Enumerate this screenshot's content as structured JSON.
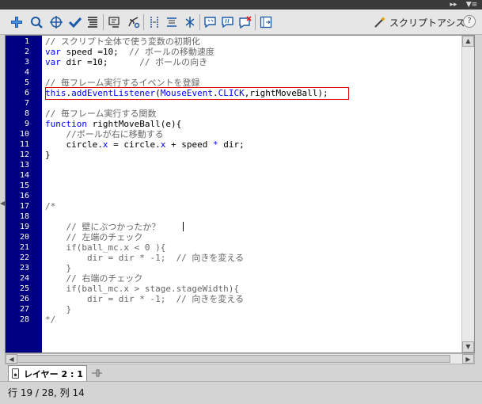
{
  "toolbar": {
    "tools": [
      {
        "icon": "add-statement-icon"
      },
      {
        "icon": "find-icon"
      },
      {
        "icon": "target-path-icon"
      },
      {
        "icon": "check-syntax-icon"
      },
      {
        "icon": "auto-format-icon"
      },
      {
        "icon": "code-hint-icon"
      },
      {
        "icon": "debug-options-icon"
      },
      {
        "icon": "collapse-between-braces-icon"
      },
      {
        "icon": "collapse-selection-icon"
      },
      {
        "icon": "expand-all-icon"
      },
      {
        "icon": "apply-block-comment-icon"
      },
      {
        "icon": "apply-line-comment-icon"
      },
      {
        "icon": "remove-comment-icon"
      },
      {
        "icon": "show-hide-toolbox-icon"
      }
    ],
    "script_assist_label": "スクリプトアシスト",
    "help_label": "?"
  },
  "editor": {
    "line_numbers": [
      "1",
      "2",
      "3",
      "4",
      "5",
      "6",
      "7",
      "8",
      "9",
      "10",
      "11",
      "12",
      "13",
      "14",
      "15",
      "16",
      "17",
      "18",
      "19",
      "20",
      "21",
      "22",
      "23",
      "24",
      "25",
      "26",
      "27",
      "28"
    ],
    "lines": [
      [
        {
          "t": "// スクリプト全体で使う変数の初期化",
          "c": "comment"
        }
      ],
      [
        {
          "t": "var",
          "c": "kw"
        },
        {
          "t": " speed =10;  ",
          "c": "plain"
        },
        {
          "t": "// ボールの移動速度",
          "c": "comment"
        }
      ],
      [
        {
          "t": "var",
          "c": "kw"
        },
        {
          "t": " dir =10;      ",
          "c": "plain"
        },
        {
          "t": "// ボールの向き",
          "c": "comment"
        }
      ],
      [],
      [
        {
          "t": "// 毎フレーム実行するイベントを登録",
          "c": "comment"
        }
      ],
      [
        {
          "t": "this",
          "c": "kw"
        },
        {
          "t": ".",
          "c": "plain"
        },
        {
          "t": "addEventListener",
          "c": "kw"
        },
        {
          "t": "(",
          "c": "plain"
        },
        {
          "t": "MouseEvent",
          "c": "kw"
        },
        {
          "t": ".",
          "c": "plain"
        },
        {
          "t": "CLICK",
          "c": "kw"
        },
        {
          "t": ",rightMoveBall);",
          "c": "plain"
        }
      ],
      [],
      [
        {
          "t": "// 毎フレーム実行する関数",
          "c": "comment"
        }
      ],
      [
        {
          "t": "function",
          "c": "kw"
        },
        {
          "t": " rightMoveBall(e){",
          "c": "plain"
        }
      ],
      [
        {
          "t": "    //ボールが右に移動する",
          "c": "comment"
        }
      ],
      [
        {
          "t": "    circle.",
          "c": "plain"
        },
        {
          "t": "x",
          "c": "kw"
        },
        {
          "t": " = circle.",
          "c": "plain"
        },
        {
          "t": "x",
          "c": "kw"
        },
        {
          "t": " + speed ",
          "c": "plain"
        },
        {
          "t": "*",
          "c": "kw"
        },
        {
          "t": " dir;",
          "c": "plain"
        }
      ],
      [
        {
          "t": "}",
          "c": "plain"
        }
      ],
      [],
      [],
      [],
      [],
      [
        {
          "t": "/*",
          "c": "gray"
        }
      ],
      [],
      [
        {
          "t": "    // 壁にぶつかったか？",
          "c": "gray"
        }
      ],
      [
        {
          "t": "    // 左端のチェック",
          "c": "gray"
        }
      ],
      [
        {
          "t": "    if(ball_mc.x < 0 ){",
          "c": "gray"
        }
      ],
      [
        {
          "t": "        dir = dir * -1;  // 向きを変える",
          "c": "gray"
        }
      ],
      [
        {
          "t": "    }",
          "c": "gray"
        }
      ],
      [
        {
          "t": "    // 右端のチェック",
          "c": "gray"
        }
      ],
      [
        {
          "t": "    if(ball_mc.x > stage.stageWidth){",
          "c": "gray"
        }
      ],
      [
        {
          "t": "        dir = dir * -1;  // 向きを変える",
          "c": "gray"
        }
      ],
      [
        {
          "t": "    }",
          "c": "gray"
        }
      ],
      [
        {
          "t": "*/",
          "c": "gray"
        }
      ]
    ],
    "highlight_color": "#e00000",
    "gutter_color": "#000080",
    "keyword_color": "#0000ff",
    "comment_color": "#666666"
  },
  "layer_tab": {
    "label": "レイヤー 2 : 1"
  },
  "status": {
    "text": "行 19 / 28, 列 14"
  }
}
